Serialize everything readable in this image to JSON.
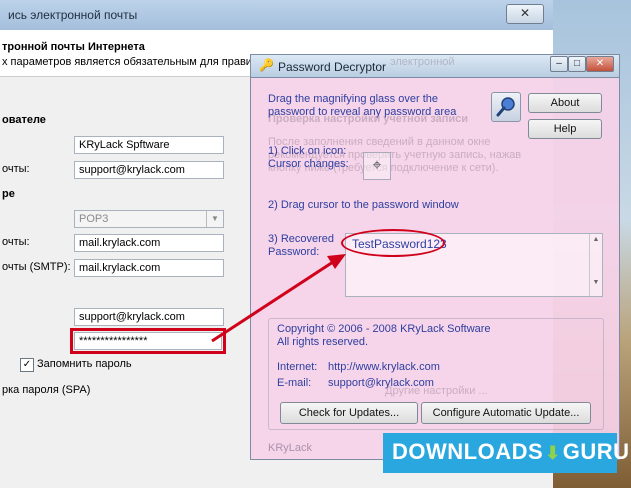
{
  "background_dialog": {
    "title": "ись электронной почты",
    "header_title": "тронной почты Интернета",
    "header_subtitle": "х параметров является обязательным для правил",
    "section_user": "ователе",
    "user_name_value": "KRyLack Spftware",
    "email_label": "очты:",
    "email_value": "support@krylack.com",
    "section_server": "ре",
    "account_type_value": "POP3",
    "incoming_label": "очты:",
    "incoming_value": "mail.krylack.com",
    "outgoing_label": "очты (SMTP):",
    "outgoing_value": "mail.krylack.com",
    "login_value": "support@krylack.com",
    "password_value": "****************",
    "remember_label": "Запомнить пароль",
    "spa_label": "рка пароля (SPA)",
    "ghost_header_right": "электронной",
    "ghost_check_title": "Проверка настройки учетной записи",
    "ghost_check_text": [
      "После заполнения сведений в данном окне",
      "рекомендуется проверить учетную запись, нажав",
      "кнопку ниже (требуется подключение к сети)."
    ],
    "ghost_settings_btn": "Другие настройки ..."
  },
  "decryptor": {
    "title": "Password Decryptor",
    "instruction": "Drag the magnifying glass over the password to reveal any password area",
    "about_label": "About",
    "help_label": "Help",
    "step1": "1) Click on icon:",
    "step1b": "Cursor changes:",
    "step2": "2) Drag cursor to the password window",
    "step3": "3) Recovered",
    "step3b": "Password:",
    "recovered_password": "TestPassword123",
    "copyright": "Copyright © 2006 - 2008 KRyLack Software",
    "rights": "All rights reserved.",
    "internet_label": "Internet:",
    "internet_value": "http://www.krylack.com",
    "email_label": "E-mail:",
    "email_value": "support@krylack.com",
    "check_updates_label": "Check for Updates...",
    "configure_label": "Configure Automatic Update...",
    "footer": "KRyLack"
  },
  "watermark": {
    "text": "DOWNLOADS",
    "suffix": "GURU"
  },
  "colors": {
    "highlight_red": "#d0021b",
    "window_pink": "#f6d2e8",
    "watermark_blue": "#2aa7df"
  }
}
